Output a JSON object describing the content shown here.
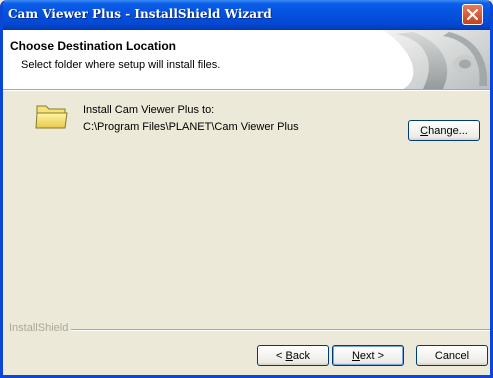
{
  "window": {
    "title": "Cam Viewer Plus - InstallShield Wizard"
  },
  "header": {
    "title": "Choose Destination Location",
    "subtitle": "Select folder where setup will install files."
  },
  "destination": {
    "label": "Install Cam Viewer Plus to:",
    "path": "C:\\Program Files\\PLANET\\Cam Viewer Plus"
  },
  "buttons": {
    "change": {
      "mnemonic": "C",
      "rest": "hange..."
    },
    "back": {
      "prefix": "< ",
      "mnemonic": "B",
      "rest": "ack"
    },
    "next": {
      "mnemonic": "N",
      "rest": "ext >"
    },
    "cancel": "Cancel"
  },
  "footer": {
    "brand": "InstallShield"
  },
  "icons": {
    "close": "close-icon",
    "folder": "folder-icon",
    "header_art": "setup-graphic-icon"
  },
  "colors": {
    "titlebar": "#0553e0",
    "close": "#c6401f",
    "face": "#ece9d8"
  }
}
